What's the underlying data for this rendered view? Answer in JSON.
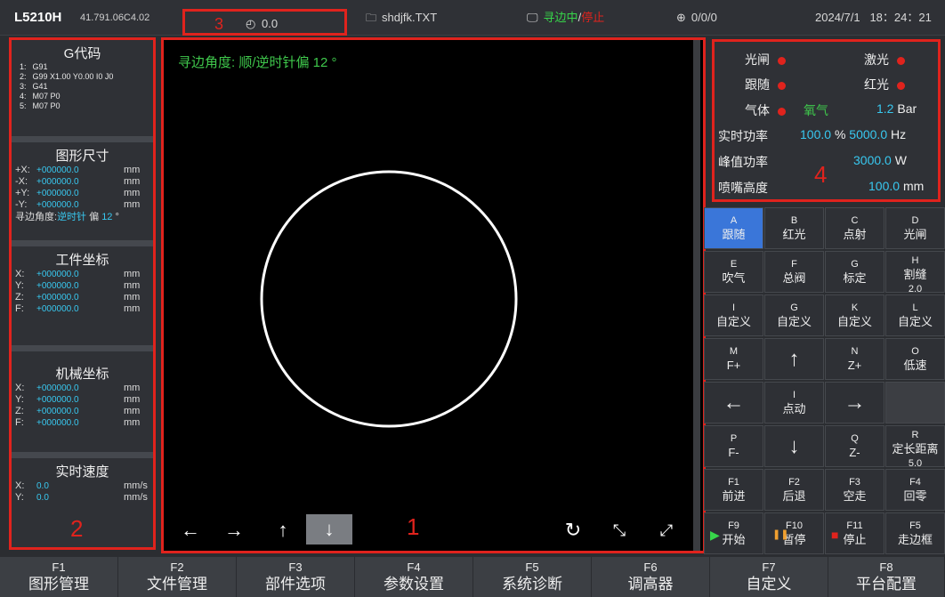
{
  "header": {
    "model": "L5210H",
    "version": "41.791.06C4.02",
    "section_num": "3",
    "speed_value": "0.0",
    "filename": "shdjfk.TXT",
    "status_active": "寻边中",
    "status_sep": "/",
    "status_stop": "停止",
    "coord": "0/0/0",
    "date": "2024/7/1",
    "time": "18：24：21"
  },
  "gcode": {
    "title": "G代码",
    "lines": [
      {
        "idx": "1:",
        "text": "G91"
      },
      {
        "idx": "2:",
        "text": "G99 X1.00 Y0.00 I0 J0"
      },
      {
        "idx": "3:",
        "text": "G41"
      },
      {
        "idx": "4:",
        "text": "M07 P0"
      },
      {
        "idx": "5:",
        "text": "M07 P0"
      }
    ]
  },
  "shape": {
    "title": "图形尺寸",
    "rows": [
      {
        "k": "+X:",
        "v": "+000000.0",
        "u": "mm"
      },
      {
        "k": "-X:",
        "v": "+000000.0",
        "u": "mm"
      },
      {
        "k": "+Y:",
        "v": "+000000.0",
        "u": "mm"
      },
      {
        "k": "-Y:",
        "v": "+000000.0",
        "u": "mm"
      }
    ],
    "seek_label": "寻边角度:",
    "seek_dir": "逆时针",
    "seek_offset": "偏",
    "seek_angle": "12",
    "seek_unit": "°"
  },
  "workpiece": {
    "title": "工件坐标",
    "rows": [
      {
        "k": "X:",
        "v": "+000000.0",
        "u": "mm"
      },
      {
        "k": "Y:",
        "v": "+000000.0",
        "u": "mm"
      },
      {
        "k": "Z:",
        "v": "+000000.0",
        "u": "mm"
      },
      {
        "k": "F:",
        "v": "+000000.0",
        "u": "mm"
      }
    ]
  },
  "machine": {
    "title": "机械坐标",
    "rows": [
      {
        "k": "X:",
        "v": "+000000.0",
        "u": "mm"
      },
      {
        "k": "Y:",
        "v": "+000000.0",
        "u": "mm"
      },
      {
        "k": "Z:",
        "v": "+000000.0",
        "u": "mm"
      },
      {
        "k": "F:",
        "v": "+000000.0",
        "u": "mm"
      }
    ]
  },
  "realtime_speed": {
    "title": "实时速度",
    "rows": [
      {
        "k": "X:",
        "v": "0.0",
        "u": "mm/s"
      },
      {
        "k": "Y:",
        "v": "0.0",
        "u": "mm/s"
      }
    ],
    "section_num": "2"
  },
  "canvas": {
    "title": "寻边角度: 顺/逆时针偏 12 °",
    "section_num": "1",
    "controls": {
      "left": "←",
      "right": "→",
      "up": "↑",
      "down": "↓",
      "refresh": "↻",
      "shrink": "⤡",
      "expand": "⤢"
    }
  },
  "status_panel": {
    "section_num": "4",
    "shutter": "光闸",
    "laser": "激光",
    "follow": "跟随",
    "red_light": "红光",
    "gas": "气体",
    "gas_type": "氧气",
    "gas_value": "1.2",
    "gas_unit": "Bar",
    "rt_power_label": "实时功率",
    "rt_power_value": "100.0",
    "rt_power_unit": "%",
    "freq_value": "5000.0",
    "freq_unit": "Hz",
    "peak_label": "峰值功率",
    "peak_value": "3000.0",
    "peak_unit": "W",
    "nozzle_label": "喷嘴高度",
    "nozzle_value": "100.0",
    "nozzle_unit": "mm",
    "dot_color": "#e0231d"
  },
  "keys": [
    {
      "k": "A",
      "t": "跟随",
      "s": ""
    },
    {
      "k": "B",
      "t": "红光",
      "s": ""
    },
    {
      "k": "C",
      "t": "点射",
      "s": ""
    },
    {
      "k": "D",
      "t": "光闸",
      "s": ""
    },
    {
      "k": "E",
      "t": "吹气",
      "s": ""
    },
    {
      "k": "F",
      "t": "总阀",
      "s": ""
    },
    {
      "k": "G",
      "t": "标定",
      "s": ""
    },
    {
      "k": "H",
      "t": "割缝",
      "s": "2.0"
    },
    {
      "k": "I",
      "t": "自定义",
      "s": ""
    },
    {
      "k": "G",
      "t": "自定义",
      "s": ""
    },
    {
      "k": "K",
      "t": "自定义",
      "s": ""
    },
    {
      "k": "L",
      "t": "自定义",
      "s": ""
    },
    {
      "k": "M",
      "t": "F+",
      "s": ""
    },
    {
      "k": "",
      "t": "↑",
      "s": ""
    },
    {
      "k": "N",
      "t": "Z+",
      "s": ""
    },
    {
      "k": "O",
      "t": "低速",
      "s": ""
    },
    {
      "k": "",
      "t": "←",
      "s": ""
    },
    {
      "k": "I",
      "t": "点动",
      "s": ""
    },
    {
      "k": "",
      "t": "→",
      "s": ""
    },
    {
      "k": "",
      "t": "",
      "s": ""
    },
    {
      "k": "P",
      "t": "F-",
      "s": ""
    },
    {
      "k": "",
      "t": "↓",
      "s": ""
    },
    {
      "k": "Q",
      "t": "Z-",
      "s": ""
    },
    {
      "k": "R",
      "t": "定长距离",
      "s": "5.0"
    },
    {
      "k": "F1",
      "t": "前进",
      "s": ""
    },
    {
      "k": "F2",
      "t": "后退",
      "s": ""
    },
    {
      "k": "F3",
      "t": "空走",
      "s": ""
    },
    {
      "k": "F4",
      "t": "回零",
      "s": ""
    },
    {
      "k": "F9",
      "t": "开始",
      "s": ""
    },
    {
      "k": "F10",
      "t": "暂停",
      "s": ""
    },
    {
      "k": "F11",
      "t": "停止",
      "s": ""
    },
    {
      "k": "F5",
      "t": "走边框",
      "s": ""
    }
  ],
  "fbar": [
    {
      "f": "F1",
      "t": "图形管理"
    },
    {
      "f": "F2",
      "t": "文件管理"
    },
    {
      "f": "F3",
      "t": "部件选项"
    },
    {
      "f": "F4",
      "t": "参数设置"
    },
    {
      "f": "F5",
      "t": "系统诊断"
    },
    {
      "f": "F6",
      "t": "调高器"
    },
    {
      "f": "F7",
      "t": "自定义"
    },
    {
      "f": "F8",
      "t": "平台配置"
    }
  ]
}
